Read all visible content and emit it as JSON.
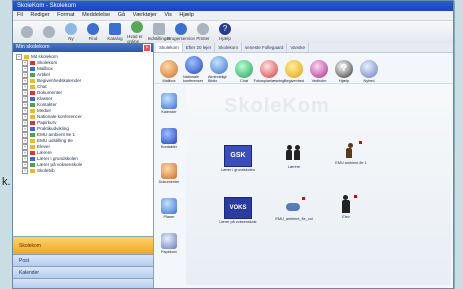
{
  "window_title": "SkoleKom - Skolekom",
  "menu": [
    "Fil",
    "Rediger",
    "Format",
    "Meddelelse",
    "Gå",
    "Værktøjer",
    "Vis",
    "Hjælp"
  ],
  "toolbar": [
    "",
    "",
    "Ny",
    "Find",
    "Katalog",
    "Hvad er online",
    "Indstillinger",
    "Brugerservice",
    "Printer",
    "Hjælp"
  ],
  "sidebar": {
    "title": "Min skolekom",
    "tree": [
      {
        "label": "Mit skolekom",
        "level": 0
      },
      {
        "label": "Skolekom",
        "level": 1
      },
      {
        "label": "Mailbox",
        "level": 1
      },
      {
        "label": "Artikel",
        "level": 1
      },
      {
        "label": "Begivenhedskalender",
        "level": 1
      },
      {
        "label": "Chat",
        "level": 1
      },
      {
        "label": "Dokumenter",
        "level": 1
      },
      {
        "label": "Klasser",
        "level": 1
      },
      {
        "label": "Kontakter",
        "level": 1
      },
      {
        "label": "Medier",
        "level": 1
      },
      {
        "label": "Nationale konferencer",
        "level": 1
      },
      {
        "label": "Papirkurv",
        "level": 1
      },
      {
        "label": "Praktikudvikling",
        "level": 1
      },
      {
        "label": "EMU ambient 8e 1",
        "level": 1
      },
      {
        "label": "EMU udstilling 8e",
        "level": 1
      },
      {
        "label": "Elever",
        "level": 1
      },
      {
        "label": "Lærere",
        "level": 1
      },
      {
        "label": "Lærer i grundskolen",
        "level": 1
      },
      {
        "label": "Lærer på voksenskole",
        "level": 1
      },
      {
        "label": "Skolebib",
        "level": 1
      }
    ],
    "nav": [
      "Skolekom",
      "Post",
      "Kalender",
      ""
    ]
  },
  "content": {
    "tabs": [
      "Skolekom",
      "Efter 20 lejer",
      "Skolekom",
      "seneste Follegaard",
      "Vanske"
    ],
    "top_icons": [
      "Mailbox",
      "Nationale konferencer",
      "Almindeligt Biblio",
      "Chat",
      "Fokusplanlæsning",
      "Begivenhed",
      "Vedholm",
      "Hjælp",
      "Nyhed"
    ],
    "left_icons": [
      "Kalender",
      "Kontakter",
      "Dokumenter",
      "Planer",
      "Papirkurv"
    ],
    "watermark": "SkoleKom",
    "workspace_icons": [
      {
        "label": "Lærer i grundskolen",
        "badge": "GSK"
      },
      {
        "label": "Lærere",
        "badge": ""
      },
      {
        "label": "EMU ambient 8e 1",
        "badge": ""
      },
      {
        "label": "Lærer på voksenskole",
        "badge": "VOKS"
      },
      {
        "label": "EMU_ambient_8e_vol",
        "badge": ""
      },
      {
        "label": "Elev",
        "badge": ""
      }
    ]
  },
  "edge_text": "k."
}
